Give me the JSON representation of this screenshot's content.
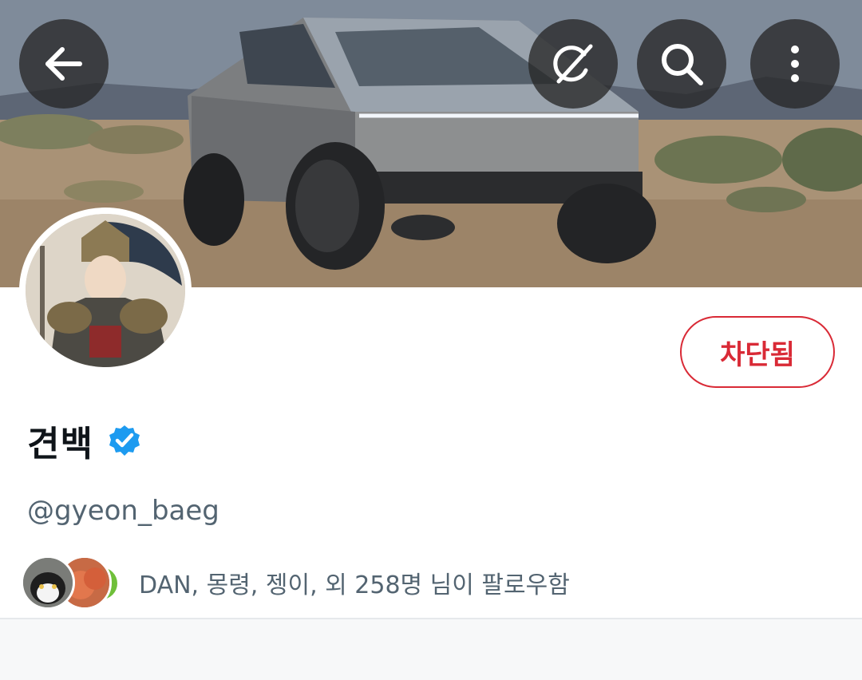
{
  "header": {
    "back_label": "Back",
    "grok_label": "Grok",
    "search_label": "Search",
    "more_label": "More options"
  },
  "profile": {
    "display_name": "견백",
    "verified": true,
    "handle": "@gyeon_baeg",
    "blocked_label": "차단됨",
    "followed_by_text": "DAN, 몽령, 젱이, 외 258명 님이 팔로우함"
  },
  "colors": {
    "blocked_red": "#d92a36",
    "verified_blue": "#1d9bf0",
    "secondary_text": "#536471"
  }
}
